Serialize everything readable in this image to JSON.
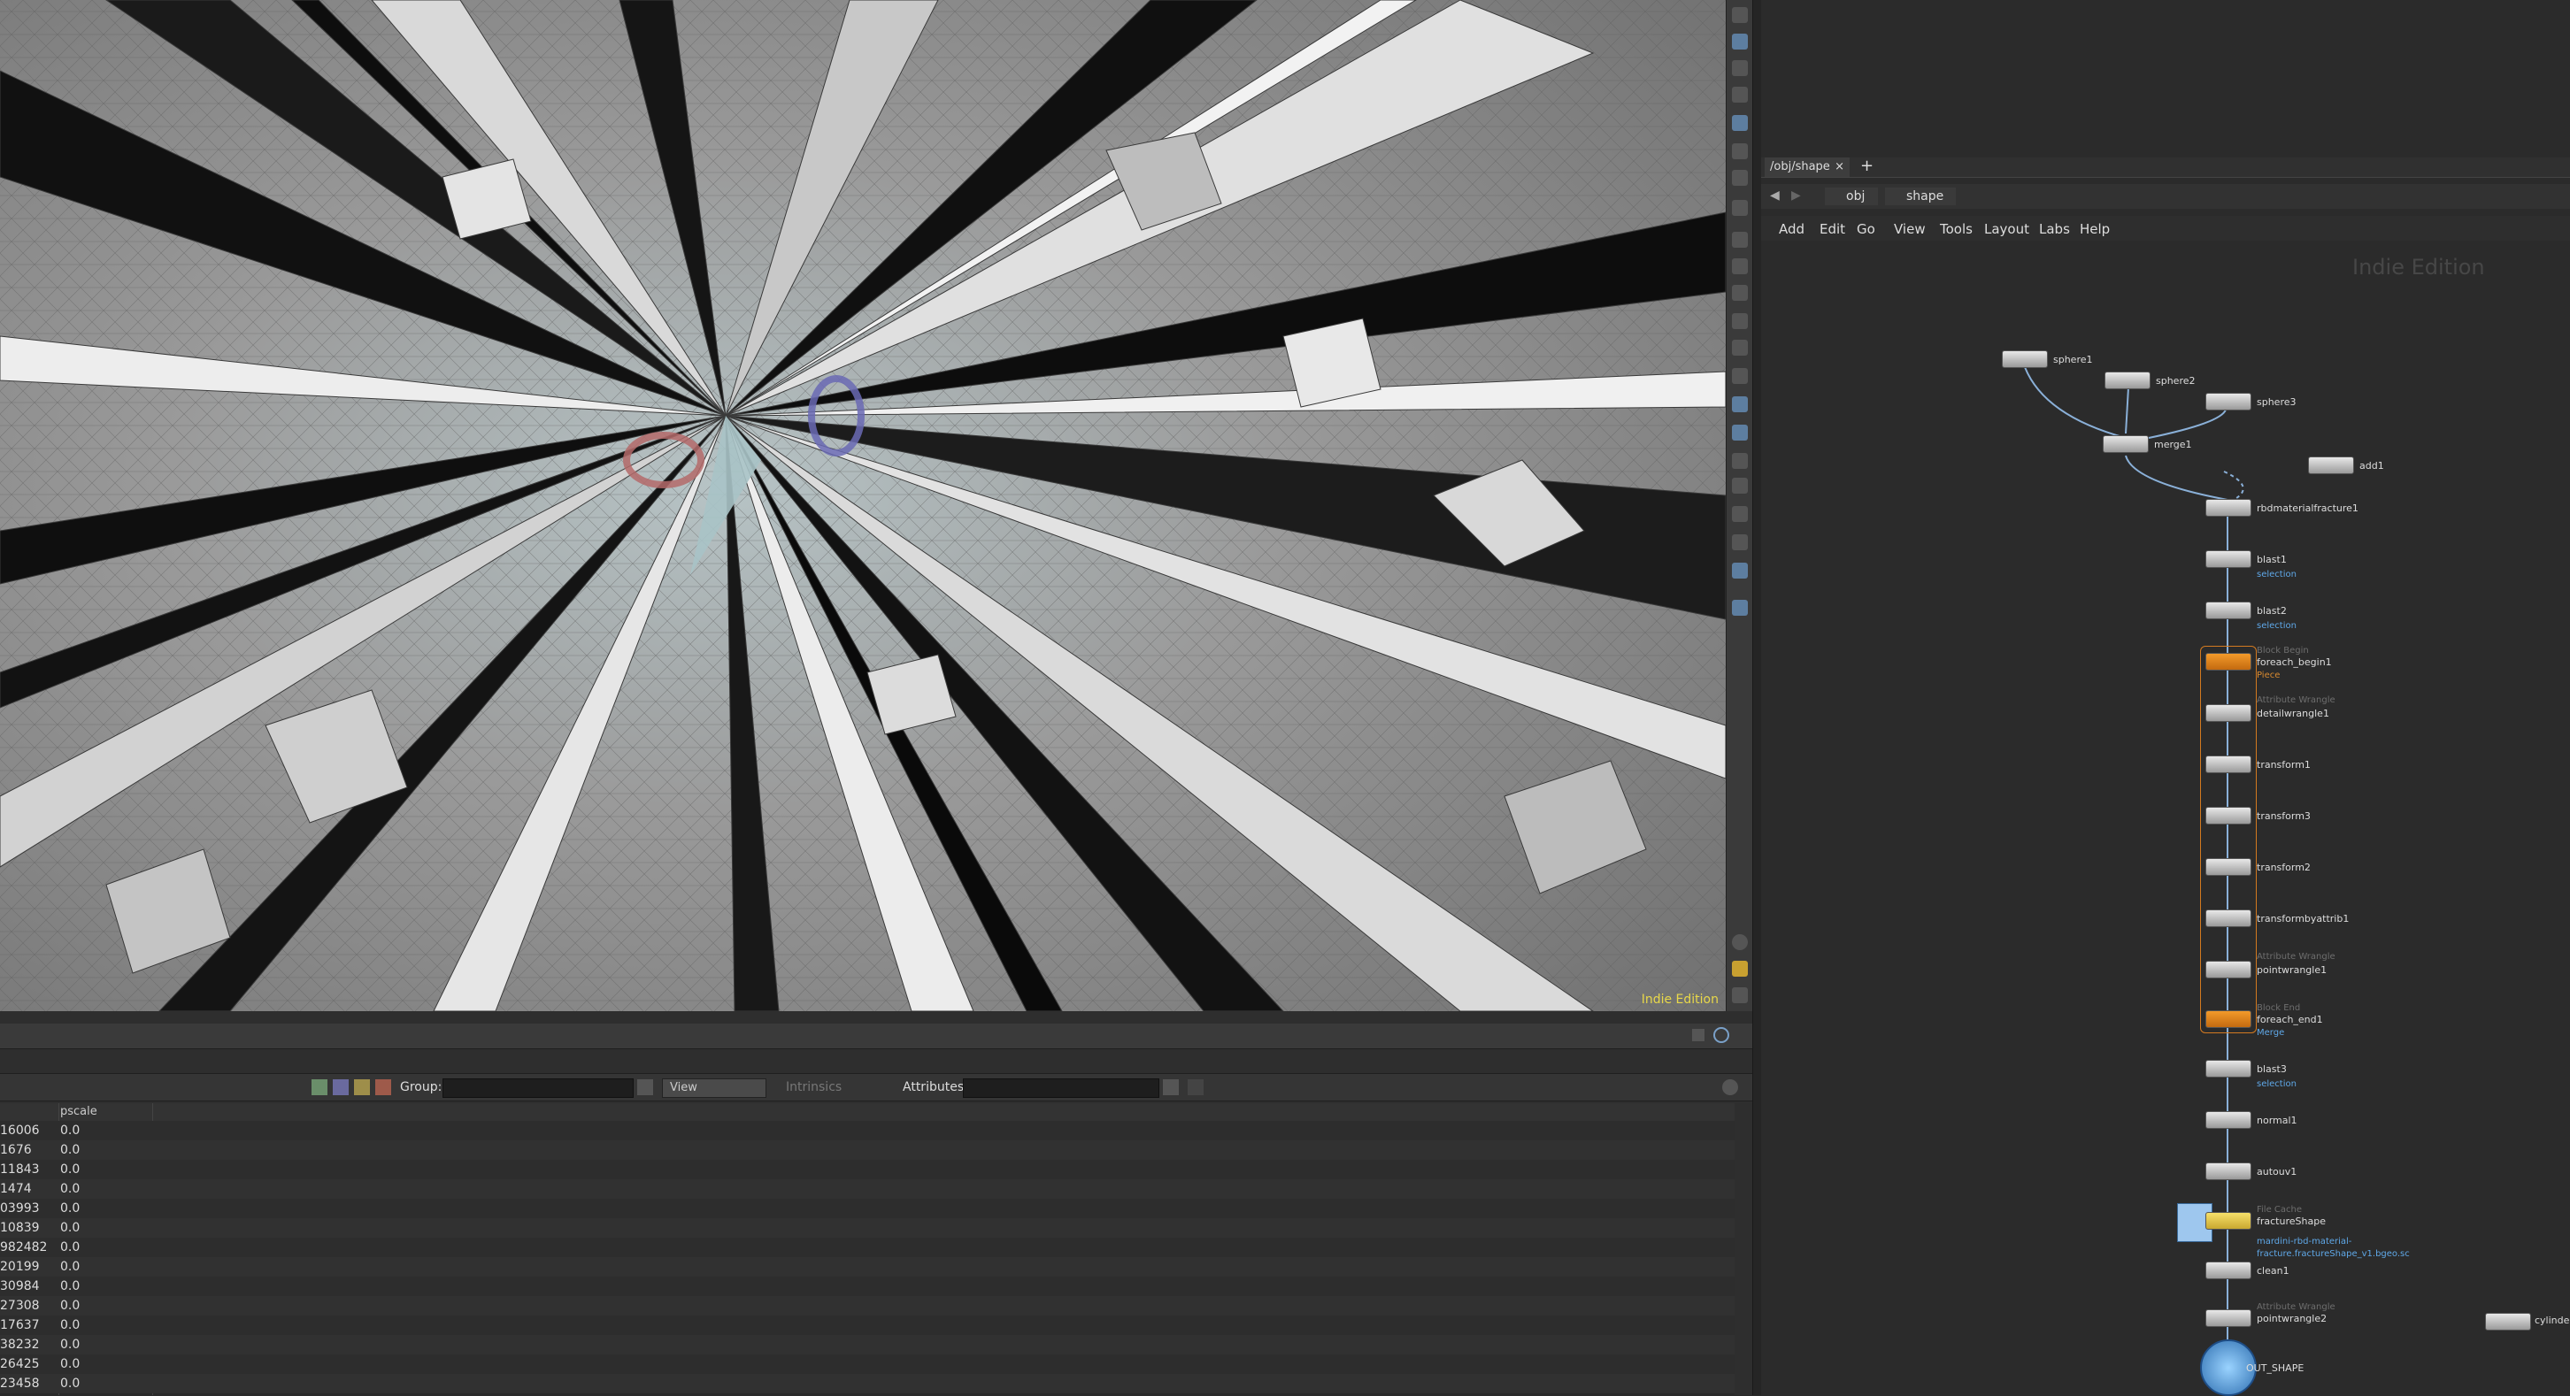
{
  "viewport": {
    "watermark": "Indie Edition"
  },
  "spreadsheet": {
    "group_label": "Group:",
    "view_label": "View",
    "intrinsics_label": "Intrinsics",
    "attributes_label": "Attributes:",
    "columns": [
      "",
      "pscale"
    ],
    "rows": [
      [
        "16006",
        "0.0"
      ],
      [
        "1676",
        "0.0"
      ],
      [
        "11843",
        "0.0"
      ],
      [
        "1474",
        "0.0"
      ],
      [
        "03993",
        "0.0"
      ],
      [
        "10839",
        "0.0"
      ],
      [
        "982482",
        "0.0"
      ],
      [
        "20199",
        "0.0"
      ],
      [
        "30984",
        "0.0"
      ],
      [
        "27308",
        "0.0"
      ],
      [
        "17637",
        "0.0"
      ],
      [
        "38232",
        "0.0"
      ],
      [
        "26425",
        "0.0"
      ],
      [
        "23458",
        "0.0"
      ]
    ]
  },
  "network": {
    "tab_label": "/obj/shape",
    "path": {
      "root": "obj",
      "current": "shape"
    },
    "menu": [
      "Add",
      "Edit",
      "Go",
      "View",
      "Tools",
      "Layout",
      "Labs",
      "Help"
    ],
    "watermark": "Indie Edition",
    "nodes": {
      "sphere1": "sphere1",
      "sphere2": "sphere2",
      "sphere3": "sphere3",
      "merge1": "merge1",
      "add1": "add1",
      "rbdmaterialfracture1": "rbdmaterialfracture1",
      "blast1": "blast1",
      "blast1_sub": "selection",
      "blast2": "blast2",
      "blast2_sub": "selection",
      "foreach_begin1_type": "Block Begin",
      "foreach_begin1": "foreach_begin1",
      "foreach_begin1_sub": "Piece",
      "detailwrangle1_type": "Attribute Wrangle",
      "detailwrangle1": "detailwrangle1",
      "transform1": "transform1",
      "transform3": "transform3",
      "transform2": "transform2",
      "transformbyattrib1": "transformbyattrib1",
      "pointwrangle1_type": "Attribute Wrangle",
      "pointwrangle1": "pointwrangle1",
      "foreach_end1_type": "Block End",
      "foreach_end1": "foreach_end1",
      "foreach_end1_sub": "Merge",
      "blast3": "blast3",
      "blast3_sub": "selection",
      "normal1": "normal1",
      "autouv1": "autouv1",
      "fractureShape_type": "File Cache",
      "fractureShape": "fractureShape",
      "fractureShape_sub1": "mardini-rbd-material-",
      "fractureShape_sub2": "fracture.fractureShape_v1.bgeo.sc",
      "clean1": "clean1",
      "pointwrangle2_type": "Attribute Wrangle",
      "pointwrangle2": "pointwrangle2",
      "out_shape": "OUT_SHAPE",
      "cylinder": "cylinder_"
    }
  }
}
